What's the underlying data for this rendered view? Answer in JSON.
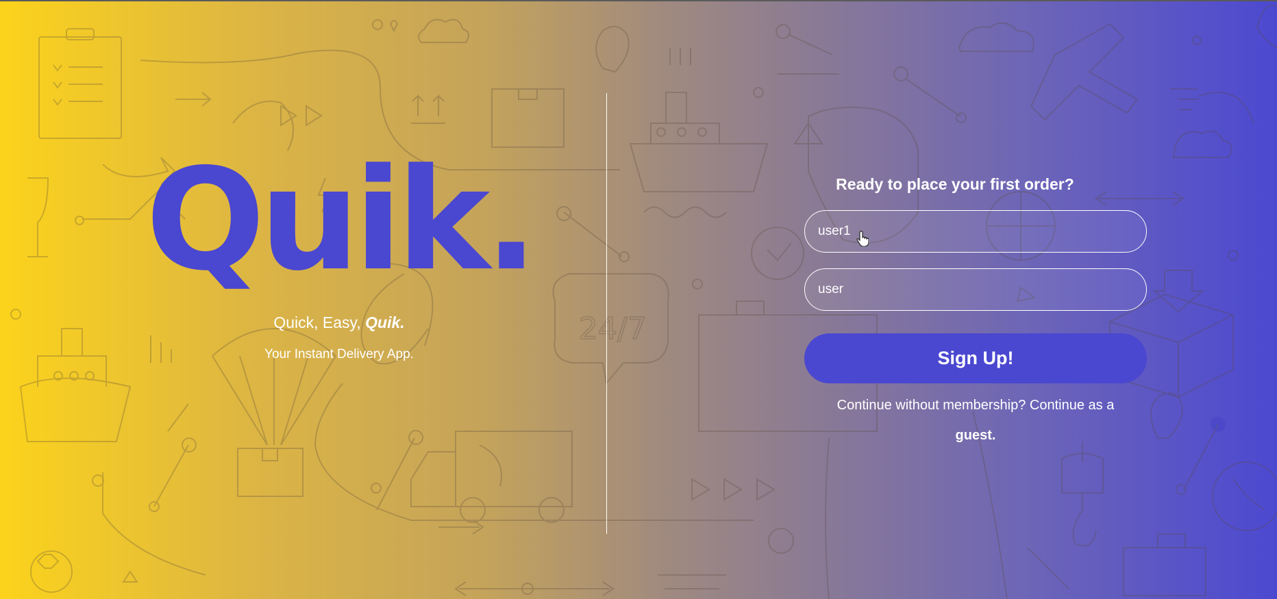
{
  "brand": {
    "logo": "Quik.",
    "tagline_prefix": "Quick, Easy, ",
    "tagline_emphasis": "Quik.",
    "subtagline": "Your Instant Delivery App."
  },
  "signup_form": {
    "title": "Ready to place your first order?",
    "username_value": "user1",
    "password_value": "user",
    "submit_label": "Sign Up!",
    "guest_prompt": "Continue without membership? Continue as a",
    "guest_link": "guest."
  },
  "colors": {
    "accent": "#4a47d0",
    "gradient_start": "#fcd31b",
    "gradient_end": "#4c49d1",
    "text": "#ffffff"
  },
  "icons": [
    "pointer-cursor-icon"
  ]
}
